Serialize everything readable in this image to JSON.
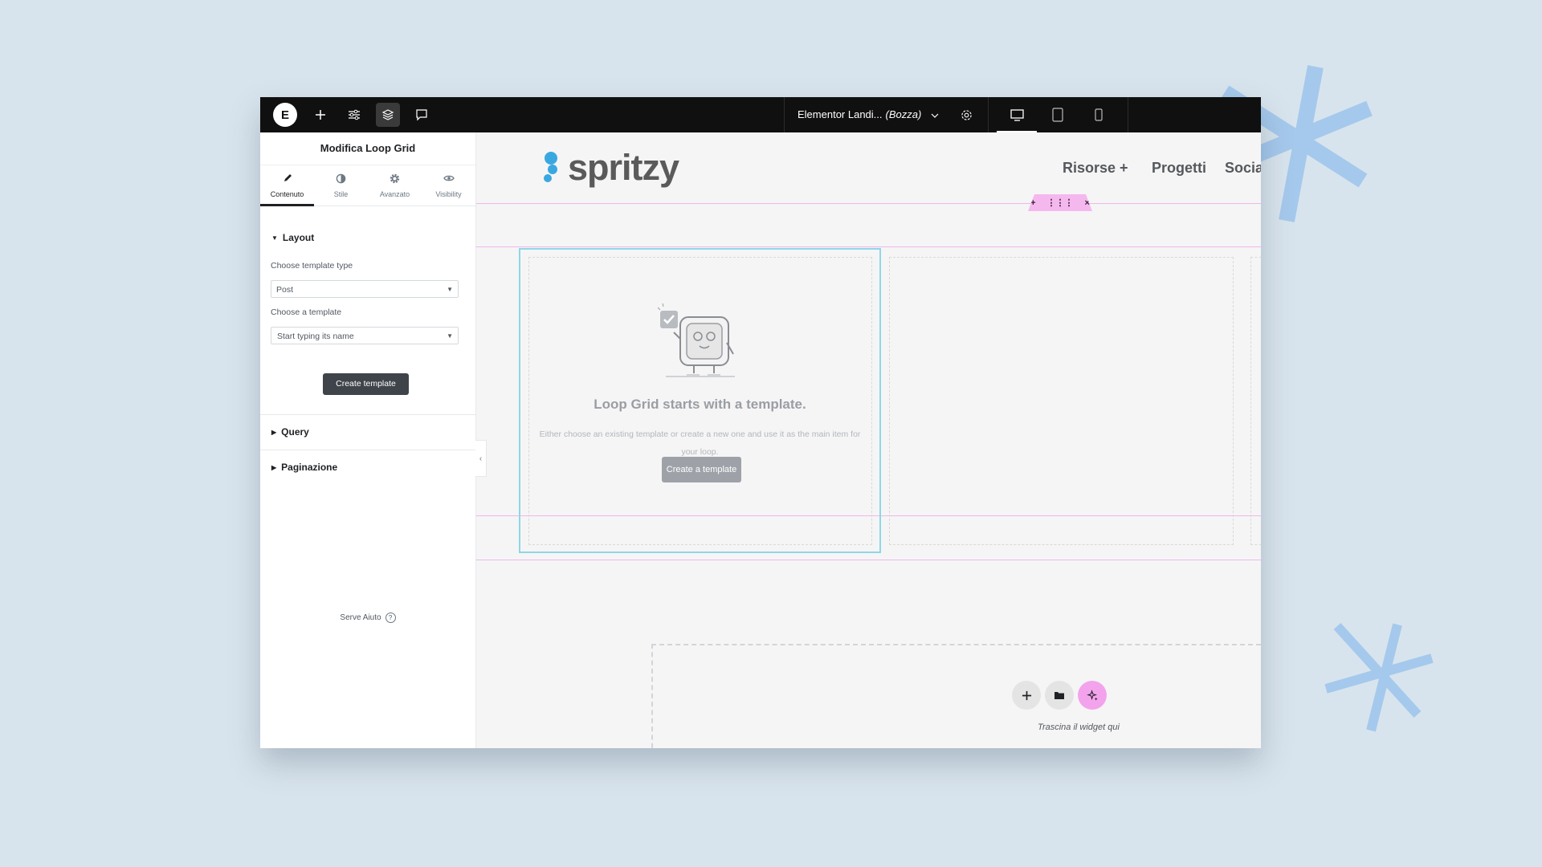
{
  "topbar": {
    "logo_glyph": "E",
    "document_title": "Elementor Landi...",
    "document_status": "(Bozza)",
    "icons": [
      "elementor-logo-icon",
      "plus-icon",
      "sliders-icon",
      "layers-icon",
      "comment-icon",
      "chevron-down-icon",
      "gear-icon",
      "desktop-icon",
      "tablet-icon",
      "mobile-icon"
    ]
  },
  "panel": {
    "title": "Modifica Loop Grid",
    "tabs": [
      {
        "label": "Contenuto",
        "icon": "pencil-icon",
        "active": true
      },
      {
        "label": "Stile",
        "icon": "half-circle-icon",
        "active": false
      },
      {
        "label": "Avanzato",
        "icon": "gear-icon",
        "active": false
      },
      {
        "label": "Visibility",
        "icon": "eye-icon",
        "active": false
      }
    ],
    "layout": {
      "heading": "Layout",
      "template_type_label": "Choose template type",
      "template_type_value": "Post",
      "template_label": "Choose a template",
      "template_placeholder": "Start typing its name",
      "create_button": "Create template"
    },
    "query_heading": "Query",
    "pagination_heading": "Paginazione",
    "help_text": "Serve Aiuto",
    "help_icon_glyph": "?"
  },
  "canvas": {
    "brand": "spritzy",
    "nav": [
      "Risorse +",
      "Progetti",
      "Social M"
    ],
    "handle_glyphs": [
      "+",
      "⋮⋮⋮",
      "×"
    ],
    "loop_empty": {
      "title": "Loop Grid starts with a template.",
      "description": "Either choose an existing template or create a new one and use it as the main item for your loop.",
      "button": "Create a template"
    },
    "drop_text": "Trascina il widget qui",
    "drop_buttons": [
      "plus-icon",
      "folder-icon",
      "ai-sparkle-icon"
    ]
  },
  "colors": {
    "topbar": "#101010",
    "accent_pink": "#f0b6ea",
    "selection_cyan": "#8fd6e6",
    "brand_blue": "#3aa8e0",
    "background": "#d8e4ed"
  }
}
